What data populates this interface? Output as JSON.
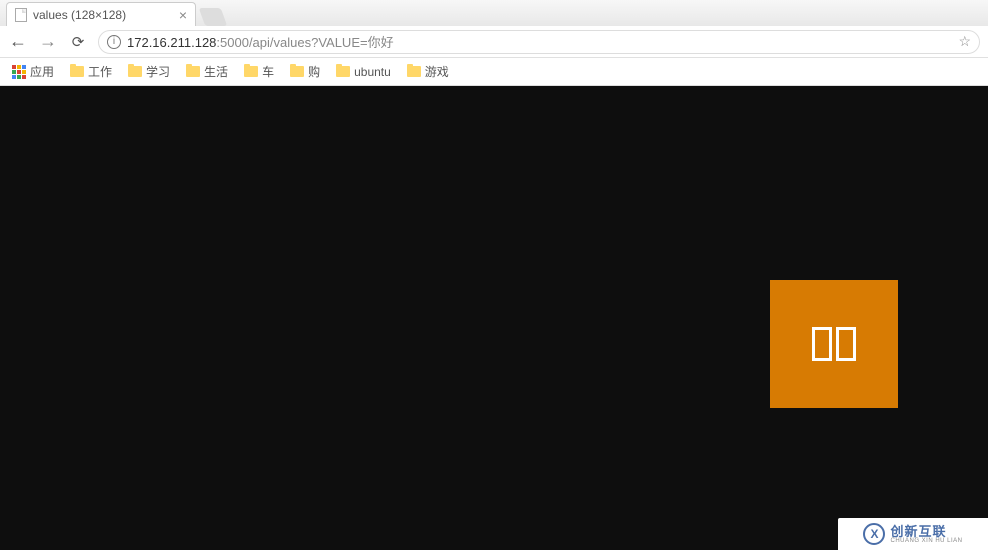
{
  "tab": {
    "title": "values (128×128)"
  },
  "url": {
    "host": "172.16.211.128",
    "rest": ":5000/api/values?VALUE=你好"
  },
  "bookmarks": {
    "apps_label": "应用",
    "items": [
      {
        "label": "工作"
      },
      {
        "label": "学习"
      },
      {
        "label": "生活"
      },
      {
        "label": "车"
      },
      {
        "label": "购"
      },
      {
        "label": "ubuntu"
      },
      {
        "label": "游戏"
      }
    ]
  },
  "watermark": {
    "cn": "创新互联",
    "en": "CHUANG XIN HU LIAN",
    "logo_letter": "X"
  },
  "content_image": {
    "placeholder_glyphs": [
      "□",
      "□"
    ],
    "bg_color": "#d77b03"
  }
}
